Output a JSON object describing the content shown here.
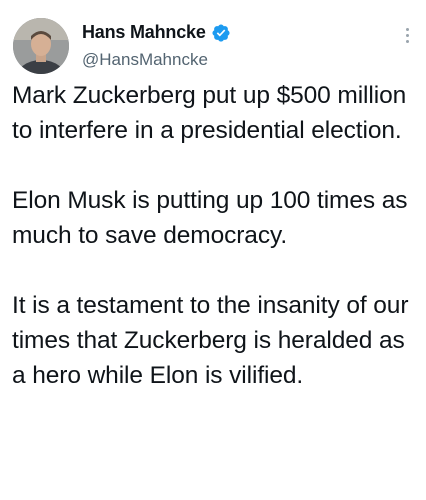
{
  "author": {
    "display_name": "Hans Mahncke",
    "handle": "@HansMahncke",
    "verified": true
  },
  "tweet": {
    "paragraphs": [
      "Mark Zuckerberg put up $500 million to interfere in a presidential election.",
      "Elon Musk is putting up 100 times as much to save democracy.",
      "It is a testament to the insanity of our times that Zuckerberg is heralded as a hero while Elon is vilified."
    ]
  },
  "icons": {
    "verified": "verified-badge-icon",
    "more": "more-options-icon"
  },
  "colors": {
    "verified_blue": "#1d9bf0",
    "handle_gray": "#536471",
    "text": "#0f1419"
  }
}
